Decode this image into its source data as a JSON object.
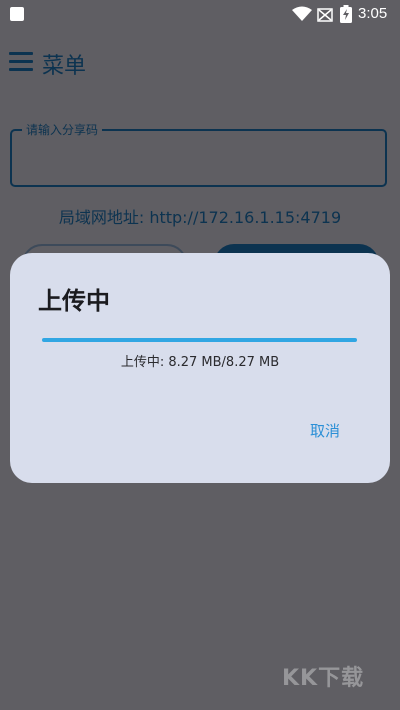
{
  "status_bar": {
    "time": "3:05",
    "icons": [
      "notification-square-icon",
      "wifi-icon",
      "no-signal-icon",
      "battery-charging-icon"
    ]
  },
  "app_bar": {
    "title": "菜单",
    "menu_icon": "hamburger-menu-icon"
  },
  "share_code": {
    "label": "请输入分享码",
    "value": ""
  },
  "lan": {
    "address_text": "局域网地址: http://172.16.1.15:4719"
  },
  "dialog": {
    "title": "上传中",
    "progress": 1.0,
    "progress_text": "上传中: 8.27 MB/8.27 MB",
    "cancel_label": "取消"
  },
  "colors": {
    "scrim_background": "#5f5e63",
    "primary_dark": "#0c3350",
    "dialog_background": "#d8ddec",
    "progress_fill": "#31a6e3",
    "cancel_text": "#2b8fd6"
  },
  "watermark": {
    "text": "KK下载"
  }
}
